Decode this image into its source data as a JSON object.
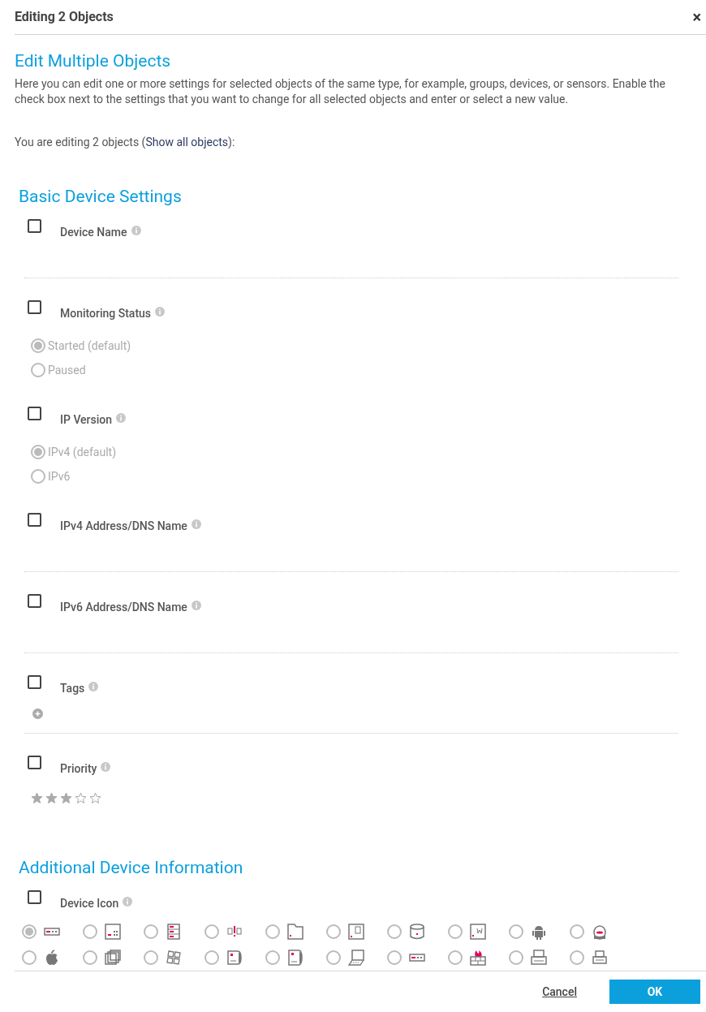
{
  "dialog": {
    "title": "Editing 2 Objects",
    "close": "×"
  },
  "intro": {
    "heading": "Edit Multiple Objects",
    "description": "Here you can edit one or more settings for selected objects of the same type, for example, groups, devices, or sensors. Enable the check box next to the settings that you want to change for all selected objects and enter or select a new value.",
    "editing_prefix": "You are editing 2 objects (",
    "link": "Show all objects",
    "editing_suffix": "):"
  },
  "sections": [
    {
      "title": "Basic Device Settings",
      "fields": [
        {
          "kind": "text",
          "label": "Device Name",
          "checked": false
        },
        {
          "kind": "radio",
          "label": "Monitoring Status",
          "checked": false,
          "options": [
            {
              "label": "Started (default)",
              "selected": true
            },
            {
              "label": "Paused",
              "selected": false
            }
          ]
        },
        {
          "kind": "radio",
          "label": "IP Version",
          "checked": false,
          "options": [
            {
              "label": "IPv4 (default)",
              "selected": true
            },
            {
              "label": "IPv6",
              "selected": false
            }
          ]
        },
        {
          "kind": "text",
          "label": "IPv4 Address/DNS Name",
          "checked": false
        },
        {
          "kind": "text",
          "label": "IPv6 Address/DNS Name",
          "checked": false
        },
        {
          "kind": "tags",
          "label": "Tags",
          "checked": false
        },
        {
          "kind": "stars",
          "label": "Priority",
          "checked": false,
          "stars": 3
        }
      ]
    },
    {
      "title": "Additional Device Information",
      "fields": [
        {
          "kind": "icons",
          "label": "Device Icon",
          "checked": false,
          "icons": [
            {
              "selected": true
            },
            {
              "selected": false
            },
            {
              "selected": false
            },
            {
              "selected": false
            },
            {
              "selected": false
            },
            {
              "selected": false
            },
            {
              "selected": false
            },
            {
              "selected": false
            },
            {
              "selected": false
            },
            {
              "selected": false
            },
            {
              "selected": false
            },
            {
              "selected": false
            },
            {
              "selected": false
            },
            {
              "selected": false
            },
            {
              "selected": false
            },
            {
              "selected": false
            },
            {
              "selected": false
            },
            {
              "selected": false
            },
            {
              "selected": false
            },
            {
              "selected": false
            }
          ]
        }
      ]
    }
  ],
  "buttons": {
    "cancel": "Cancel",
    "ok": "OK"
  }
}
